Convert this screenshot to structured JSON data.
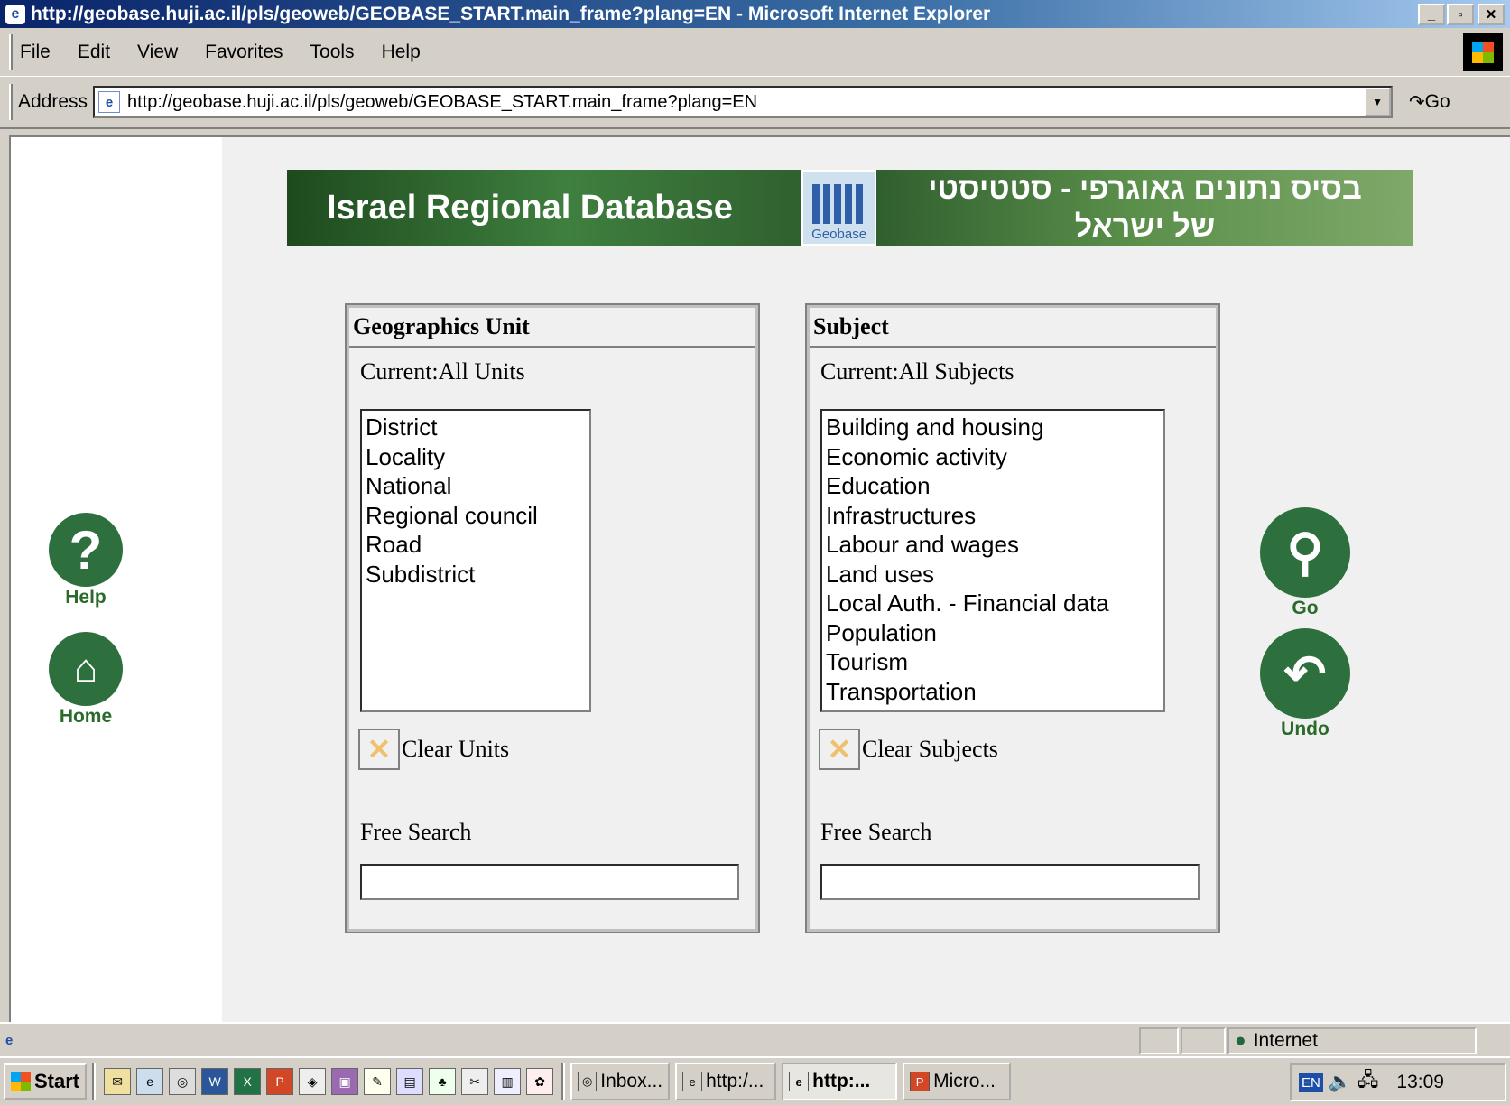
{
  "window": {
    "title": "http://geobase.huji.ac.il/pls/geoweb/GEOBASE_START.main_frame?plang=EN - Microsoft Internet Explorer"
  },
  "menu": {
    "items": [
      "File",
      "Edit",
      "View",
      "Favorites",
      "Tools",
      "Help"
    ]
  },
  "address": {
    "label": "Address",
    "url": "http://geobase.huji.ac.il/pls/geoweb/GEOBASE_START.main_frame?plang=EN",
    "go": "Go"
  },
  "banner": {
    "english": "Israel Regional Database",
    "logo_text": "Geobase",
    "hebrew_line1": "בסיס נתונים גאוגרפי - סטטיסטי",
    "hebrew_line2": "של ישראל"
  },
  "geo_panel": {
    "title": "Geographics Unit",
    "current": "Current:All Units",
    "items": [
      "District",
      "Locality",
      "National",
      "Regional council",
      "Road",
      "Subdistrict"
    ],
    "clear": "Clear Units",
    "search_label": "Free Search",
    "search_value": ""
  },
  "subject_panel": {
    "title": "Subject",
    "current": "Current:All Subjects",
    "items": [
      "Building and housing",
      "Economic activity",
      "Education",
      "Infrastructures",
      "Labour and wages",
      "Land uses",
      "Local Auth. - Financial data",
      "Population",
      "Tourism",
      "Transportation"
    ],
    "clear": "Clear Subjects",
    "search_label": "Free Search",
    "search_value": ""
  },
  "nav": {
    "help": "Help",
    "home": "Home",
    "go": "Go",
    "undo": "Undo"
  },
  "status": {
    "zone": "Internet"
  },
  "taskbar": {
    "start": "Start",
    "tasks": [
      "Inbox...",
      "http:/...",
      "http:...",
      "Micro..."
    ],
    "clock": "13:09",
    "lang": "EN"
  }
}
